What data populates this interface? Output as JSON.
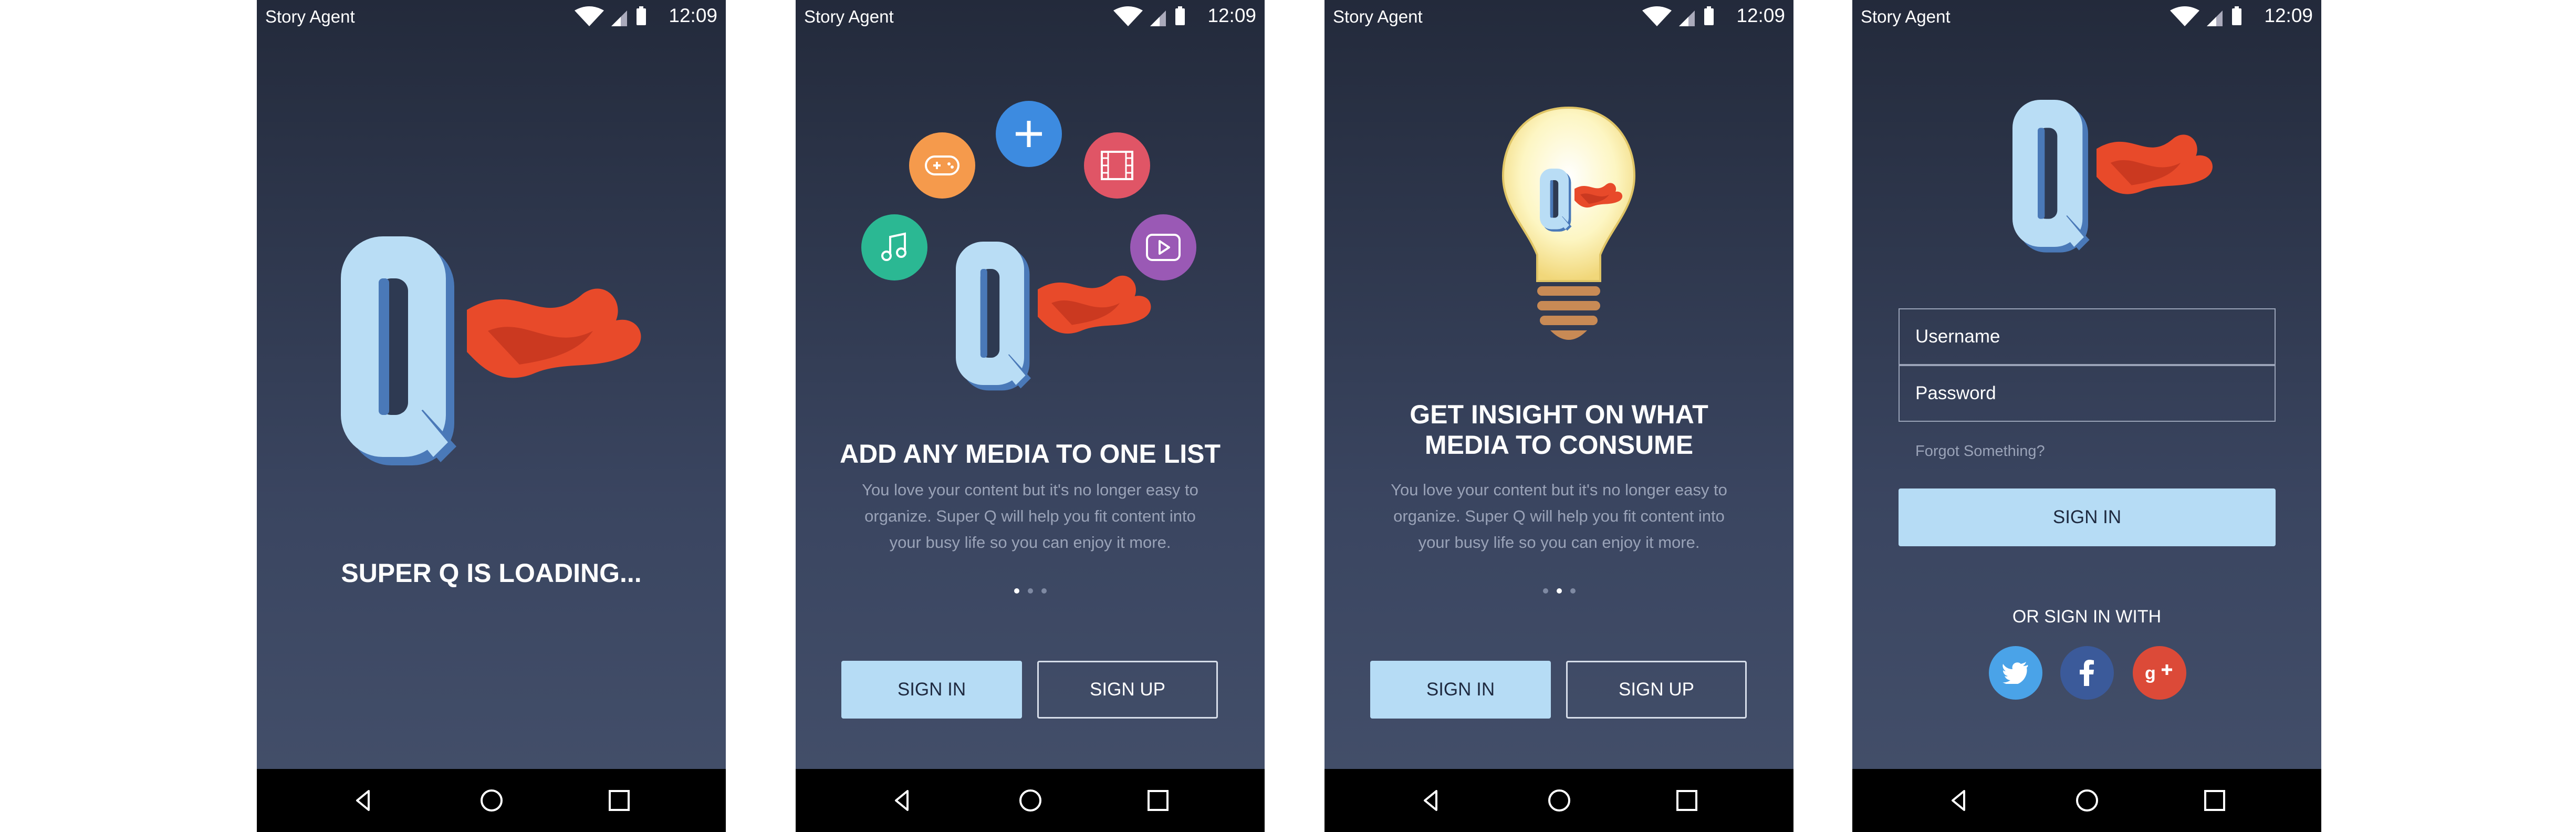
{
  "status_bar": {
    "carrier": "Story Agent",
    "time": "12:09"
  },
  "screen1": {
    "loading_text": "SUPER Q IS LOADING..."
  },
  "screen2": {
    "heading": "ADD ANY MEDIA TO ONE LIST",
    "description": "You love your content but it's no longer easy to organize.  Super Q will help you fit content into your busy life so you can enjoy it more.",
    "sign_in": "SIGN IN",
    "sign_up": "SIGN UP",
    "page_index": 1,
    "page_count": 3,
    "media_icons": [
      "gamepad-icon",
      "plus-icon",
      "film-icon",
      "music-icon",
      "play-icon"
    ]
  },
  "screen3": {
    "heading": "GET INSIGHT ON WHAT MEDIA TO CONSUME",
    "description": "You love your content but it's no longer easy to organize.  Super Q will help you fit content into your busy life so you can enjoy it more.",
    "sign_in": "SIGN IN",
    "sign_up": "SIGN UP",
    "page_index": 2,
    "page_count": 3
  },
  "screen4": {
    "username_placeholder": "Username",
    "password_placeholder": "Password",
    "forgot": "Forgot Something?",
    "sign_in": "SIGN IN",
    "or_sign_in_with": "OR SIGN IN WITH",
    "social": [
      "twitter-icon",
      "facebook-icon",
      "google-plus-icon"
    ]
  },
  "colors": {
    "accent": "#b6dcf5",
    "cape": "#e84a2a",
    "twitter": "#4aa3e8",
    "facebook": "#3b5a9a",
    "google_plus": "#dc4a38",
    "plus": "#3d8be0",
    "gamepad": "#f59a4c",
    "film": "#e05566",
    "music": "#2bb893",
    "play": "#9a59b5"
  }
}
